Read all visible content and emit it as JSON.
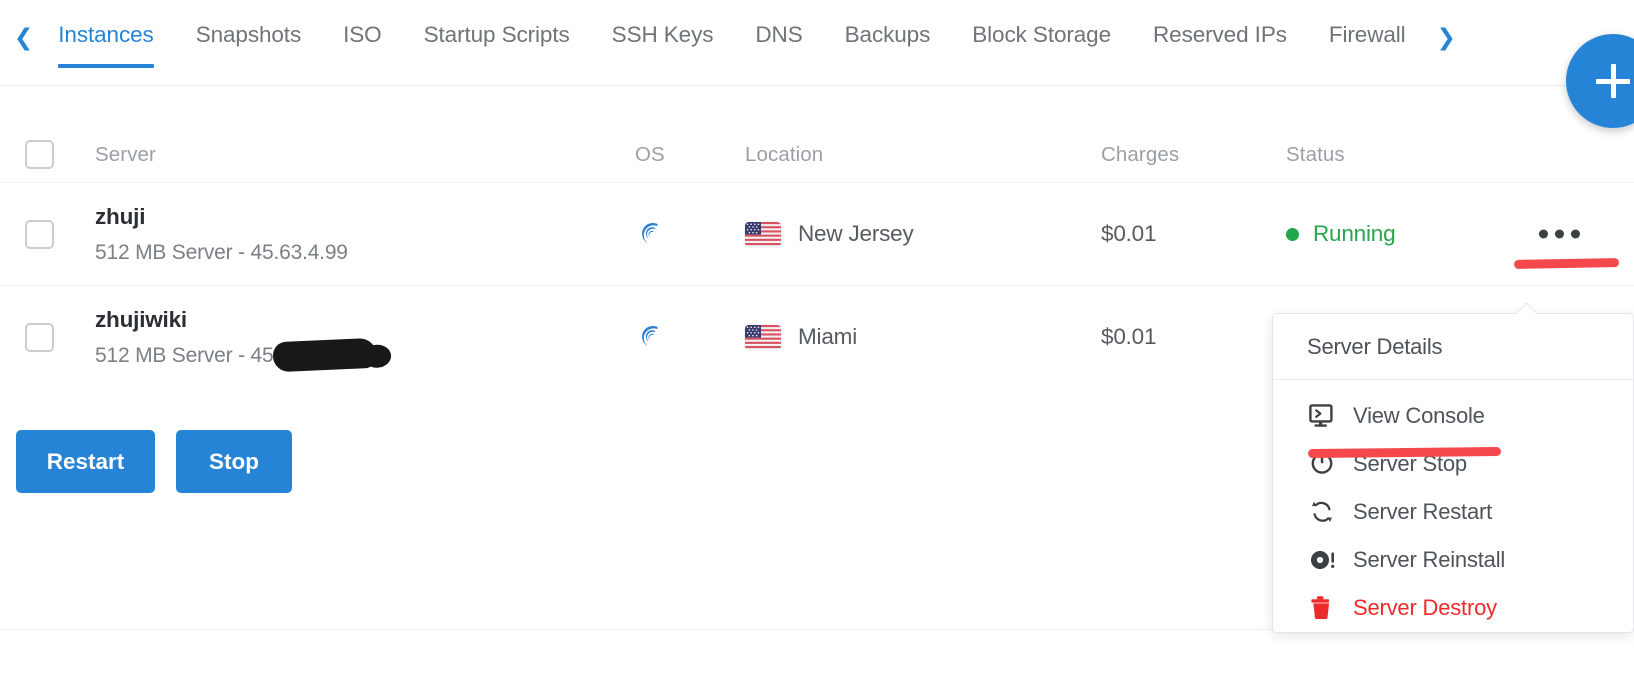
{
  "nav": {
    "prev_icon": "chevron-left-icon",
    "next_icon": "chevron-right-icon",
    "add_icon": "plus-icon",
    "tabs": [
      {
        "label": "Instances",
        "active": true
      },
      {
        "label": "Snapshots",
        "active": false
      },
      {
        "label": "ISO",
        "active": false
      },
      {
        "label": "Startup Scripts",
        "active": false
      },
      {
        "label": "SSH Keys",
        "active": false
      },
      {
        "label": "DNS",
        "active": false
      },
      {
        "label": "Backups",
        "active": false
      },
      {
        "label": "Block Storage",
        "active": false
      },
      {
        "label": "Reserved IPs",
        "active": false
      },
      {
        "label": "Firewall",
        "active": false
      }
    ]
  },
  "table": {
    "columns": [
      "Server",
      "OS",
      "Location",
      "Charges",
      "Status"
    ],
    "rows": [
      {
        "name": "zhuji",
        "spec": "512 MB Server - 45.63.4.99",
        "redacted": false,
        "os_icon": "debian-icon",
        "location": "New Jersey",
        "flag_icon": "us-flag-icon",
        "charges": "$0.01",
        "status": "Running",
        "status_color": "#2aa54d"
      },
      {
        "name": "zhujiwiki",
        "spec": "512 MB Server - 45.",
        "redacted": true,
        "os_icon": "debian-icon",
        "location": "Miami",
        "flag_icon": "us-flag-icon",
        "charges": "$0.01",
        "status": "",
        "status_color": "#2aa54d"
      }
    ]
  },
  "actions": {
    "restart_label": "Restart",
    "stop_label": "Stop"
  },
  "dropdown": {
    "header": {
      "label": "Server Details"
    },
    "items": [
      {
        "label": "View Console",
        "icon": "console-icon",
        "danger": false
      },
      {
        "label": "Server Stop",
        "icon": "power-icon",
        "danger": false
      },
      {
        "label": "Server Restart",
        "icon": "refresh-icon",
        "danger": false
      },
      {
        "label": "Server Reinstall",
        "icon": "reinstall-disc-icon",
        "danger": false
      },
      {
        "label": "Server Destroy",
        "icon": "trash-icon",
        "danger": true
      }
    ]
  },
  "colors": {
    "accent": "#2684d6",
    "running": "#2aa54d",
    "danger": "#ee2b2b",
    "marker": "#f4484c"
  }
}
